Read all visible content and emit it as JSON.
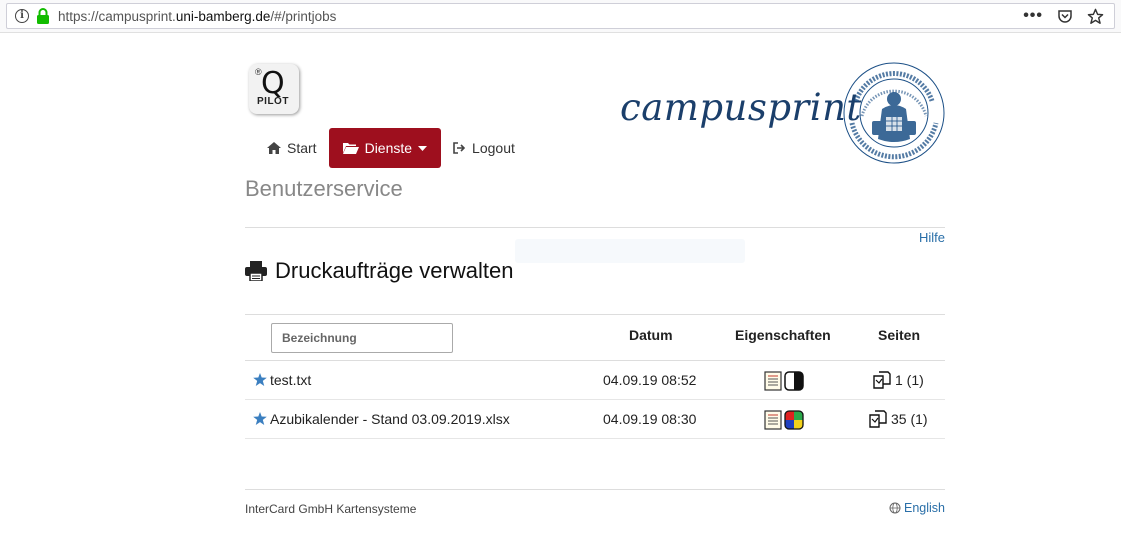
{
  "browser": {
    "url_prefix": "https://campusprint.",
    "url_domain": "uni-bamberg.de",
    "url_path": "/#/printjobs"
  },
  "logo": {
    "letter": "Q",
    "reg": "®",
    "sub": "PILOT"
  },
  "brand": {
    "name": "campusprint"
  },
  "nav": {
    "start": "Start",
    "services": "Dienste",
    "logout": "Logout"
  },
  "section_title": "Benutzerservice",
  "help_link": "Hilfe",
  "heading": "Druckaufträge verwalten",
  "table": {
    "filter_placeholder": "Bezeichnung",
    "col_date": "Datum",
    "col_props": "Eigenschaften",
    "col_pages": "Seiten",
    "rows": [
      {
        "name": "test.txt",
        "date": "04.09.19 08:52",
        "color_mode": "bw",
        "pages": "1 (1)"
      },
      {
        "name": "Azubikalender - Stand 03.09.2019.xlsx",
        "date": "04.09.19 08:30",
        "color_mode": "color",
        "pages": "35 (1)"
      }
    ]
  },
  "footer": {
    "company": "InterCard GmbH Kartensysteme",
    "language": "English"
  },
  "colors": {
    "accent": "#9e0f1e",
    "link": "#2a6fa8",
    "brand": "#1b3f6b"
  }
}
